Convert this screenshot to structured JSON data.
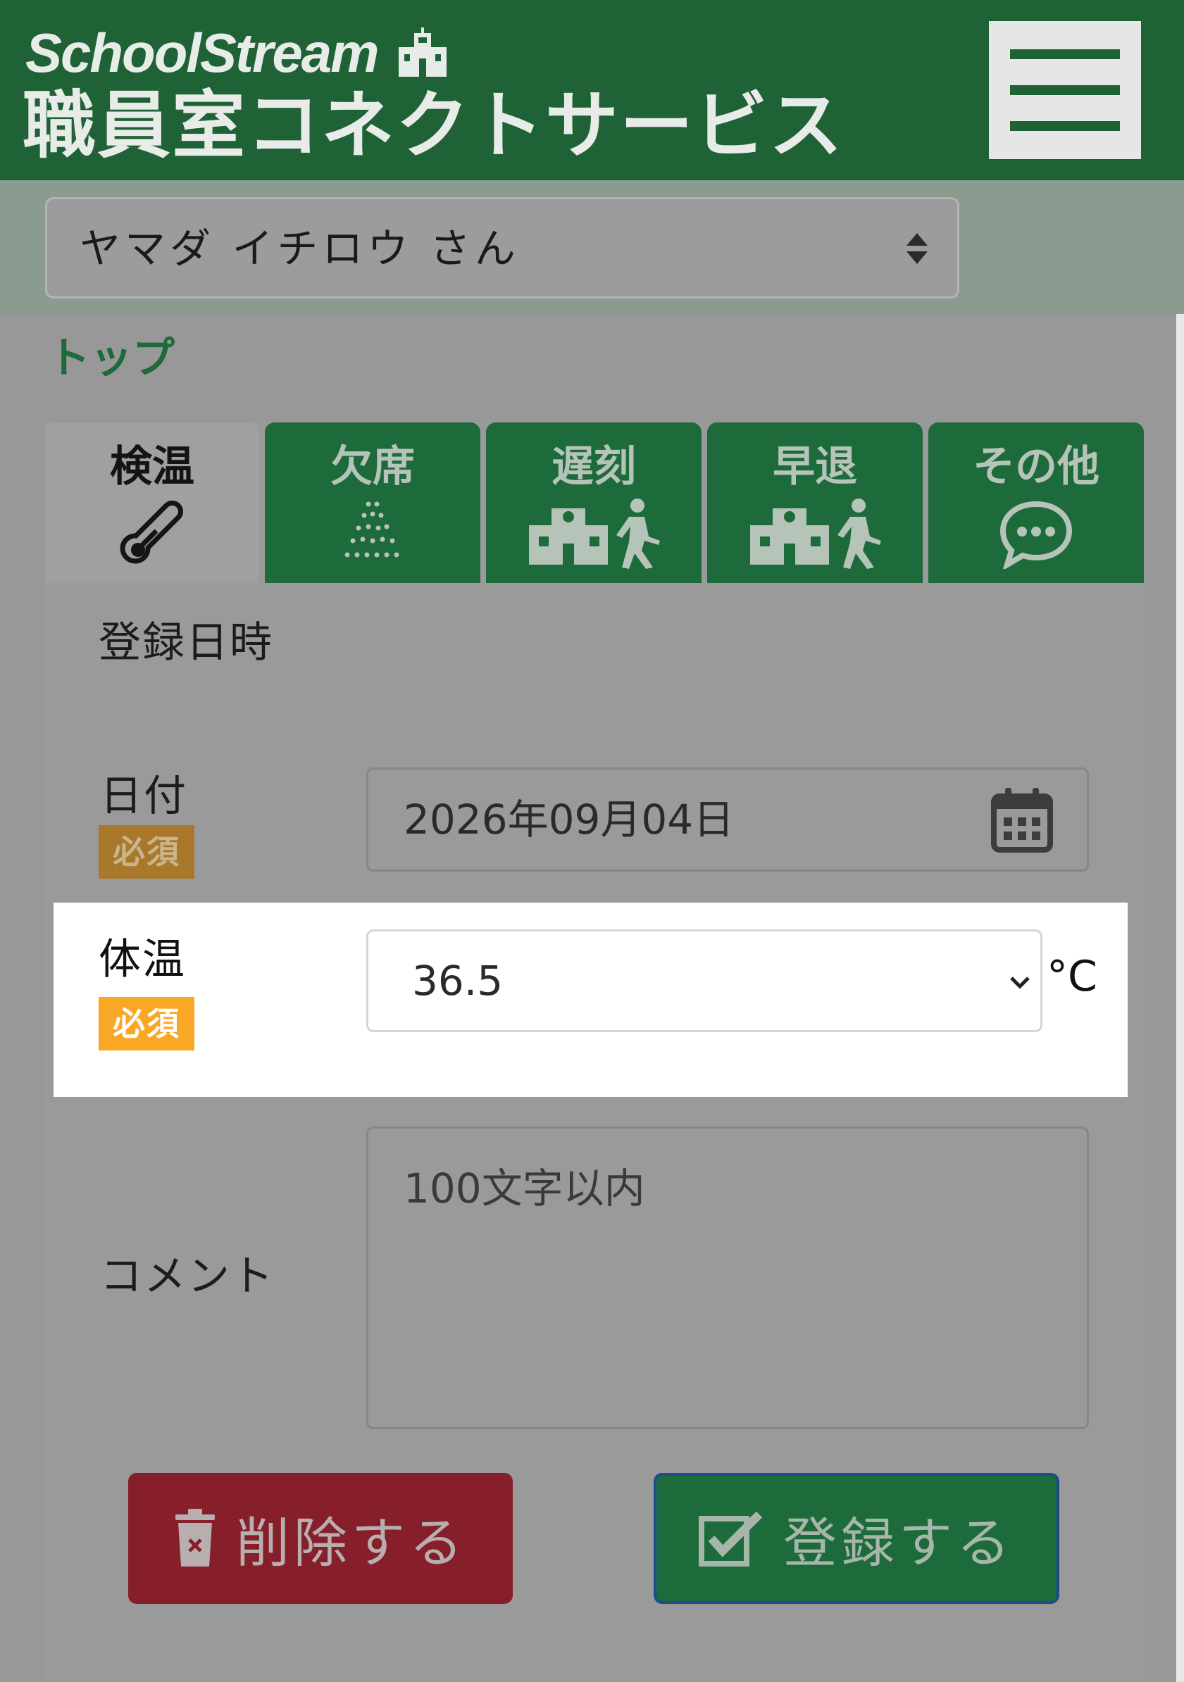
{
  "header": {
    "brand_name": "SchoolStream",
    "service_name": "職員室コネクトサービス",
    "menu_icon": "hamburger-menu-icon",
    "school_icon": "school-building-icon"
  },
  "user_select": {
    "value": "ヤマダ イチロウ さん",
    "icon": "sort-arrows-icon"
  },
  "breadcrumb": "トップ",
  "tabs": [
    {
      "label": "検温",
      "icon": "thermometer-icon",
      "active": true
    },
    {
      "label": "欠席",
      "icon": "dots-icon",
      "active": false
    },
    {
      "label": "遅刻",
      "icon": "school-walking-person-icon",
      "active": false
    },
    {
      "label": "早退",
      "icon": "school-walking-person-icon",
      "active": false
    },
    {
      "label": "その他",
      "icon": "chat-bubble-icon",
      "active": false
    }
  ],
  "form": {
    "registered_label": "登録日時",
    "date_label": "日付",
    "date_required": "必須",
    "date_value": "2026年09月04日",
    "date_icon": "calendar-icon",
    "temp_label": "体温",
    "temp_required": "必須",
    "temp_value": "36.5",
    "temp_unit": "°C",
    "comment_label": "コメント",
    "comment_placeholder": "100文字以内"
  },
  "buttons": {
    "delete_label": "削除する",
    "delete_icon": "trash-icon",
    "submit_label": "登録する",
    "submit_icon": "checkbox-check-icon"
  },
  "colors": {
    "brand_green": "#1f6236",
    "tab_green": "#1d6a3a",
    "overlay_gray": "#989898",
    "required_orange": "#f8a824",
    "delete_red": "#861f29",
    "submit_border_blue": "#1b4c8e"
  }
}
